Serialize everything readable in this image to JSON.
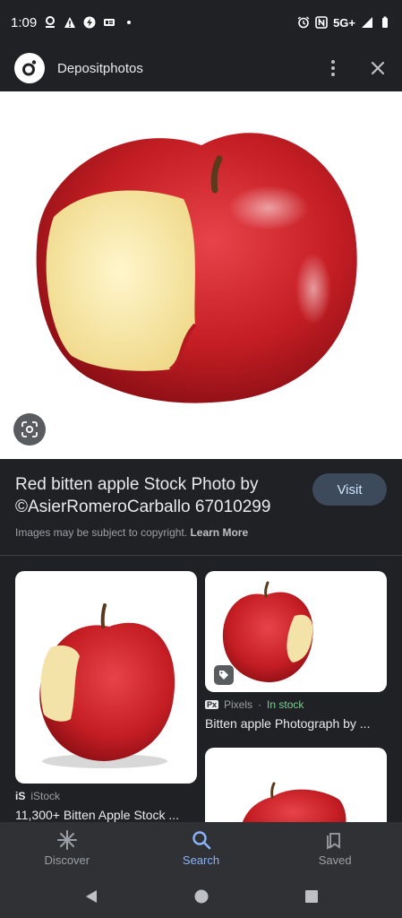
{
  "status_bar": {
    "time": "1:09",
    "network": "5G+"
  },
  "header": {
    "site_name": "Depositphotos"
  },
  "info": {
    "title": "Red bitten apple Stock Photo by ©AsierRomeroCarballo 67010299",
    "visit_label": "Visit",
    "copyright_text": "Images may be subject to copyright.",
    "learn_more": "Learn More"
  },
  "results": [
    {
      "source_badge": "iS",
      "source": "iStock",
      "stock": "",
      "title": "11,300+ Bitten Apple Stock ..."
    },
    {
      "source_badge": "Px",
      "source": "Pixels",
      "stock": "In stock",
      "title": "Bitten apple Photograph by ..."
    },
    {
      "source_badge": "",
      "source": "",
      "stock": "",
      "title": ""
    }
  ],
  "result_separator": " · ",
  "bottom_nav": [
    {
      "label": "Discover",
      "icon": "asterisk-icon",
      "active": false
    },
    {
      "label": "Search",
      "icon": "search-icon",
      "active": true
    },
    {
      "label": "Saved",
      "icon": "bookmark-icon",
      "active": false
    }
  ],
  "colors": {
    "background": "#202124",
    "accent": "#8ab4f8",
    "visit_button": "#3c4a5c",
    "in_stock": "#81c995",
    "apple_red": "#c41e24"
  }
}
